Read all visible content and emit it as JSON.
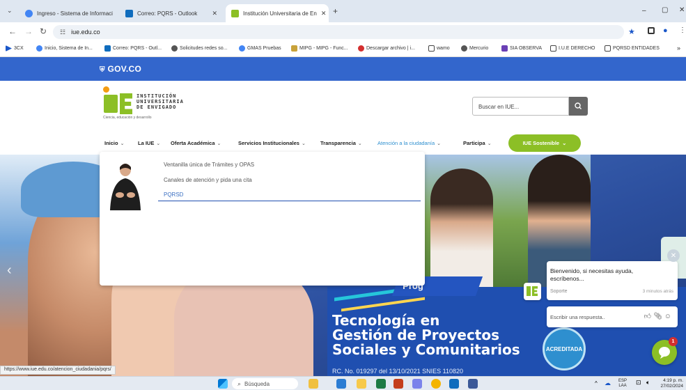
{
  "browser": {
    "tabs": [
      {
        "label": "Ingreso - Sistema de Informaci",
        "icon": "google-icon"
      },
      {
        "label": "Correo: PQRS - Outlook",
        "icon": "outlook-icon"
      },
      {
        "label": "Institución Universitaria de En",
        "icon": "iue-icon"
      }
    ],
    "new_tab": "+",
    "url": "iue.edu.co",
    "window_controls": [
      "–",
      "▢",
      "✕"
    ],
    "bookmarks": [
      "3CX",
      "Inicio, Sistema de In...",
      "Correo: PQRS - Outl...",
      "Solicitudes redes so...",
      "GMAS Pruebas",
      "MIPG - MIPG - Func...",
      "Descargar archivo | i...",
      "wamo",
      "Mercurio",
      "SIA OBSERVA",
      "I.U.E DERECHO",
      "PQRSD ENTIDADES"
    ],
    "bookmarks_more": "»"
  },
  "gov": {
    "logo_text": "GOV.CO"
  },
  "header": {
    "logo_lines": [
      "INSTITUCIÓN",
      "UNIVERSITARIA",
      "DE ENVIGADO"
    ],
    "logo_tagline": "Ciencia, educación y desarrollo",
    "search_placeholder": "Buscar en IUE..."
  },
  "menu": {
    "items": [
      "Inicio",
      "La IUE",
      "Oferta Académica",
      "Servicios Institucionales",
      "Transparencia",
      "Atención a la ciudadanía",
      "Participa"
    ],
    "sostenible": "IUE Sostenible"
  },
  "dropdown": {
    "items": [
      "Ventanilla única de Trámites y OPAS",
      "Canales de atención y pida una cita",
      "PQRSD"
    ]
  },
  "hero": {
    "program_tag": "Prog",
    "title_lines": [
      "Tecnología en",
      "Gestión de Proyectos",
      "Sociales y Comunitarios"
    ],
    "snies": "RC. No. 019297 del 13/10/2021 SNIES 110820",
    "seal": "ACREDITADA"
  },
  "chat": {
    "message": "Bienvenido, si necesitas ayuda, escríbenos...",
    "source": "Soporte",
    "time": "3 minutos atrás",
    "input_placeholder": "Escribir una respuesta..",
    "close": "✕",
    "badge": "1"
  },
  "status_url": "https://www.iue.edu.co/atencion_ciudadania/pqrs/",
  "taskbar": {
    "search": "Búsqueda",
    "lang_top": "ESP",
    "lang_bottom": "LAA",
    "time": "4:19 p. m.",
    "date": "27/02/2024"
  },
  "colors": {
    "gov_blue": "#3366cc",
    "accent_green": "#8cbf26",
    "hero_blue": "#1f4fb0"
  }
}
